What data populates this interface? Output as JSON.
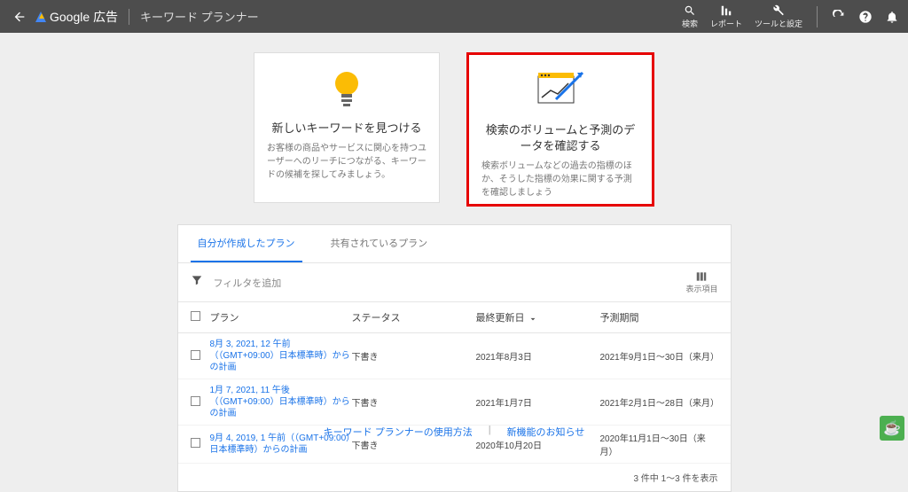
{
  "header": {
    "product_label": "Google 広告",
    "tool_title": "キーワード プランナー",
    "search_label": "検索",
    "report_label": "レポート",
    "tools_label": "ツールと設定"
  },
  "cards": {
    "discover": {
      "title": "新しいキーワードを見つける",
      "desc": "お客様の商品やサービスに関心を持つユーザーへのリーチにつながる、キーワードの候補を探してみましょう。"
    },
    "volume": {
      "title": "検索のボリュームと予測のデータを確認する",
      "desc": "検索ボリュームなどの過去の指標のほか、そうした指標の効果に関する予測を確認しましょう"
    }
  },
  "tabs": {
    "mine": "自分が作成したプラン",
    "shared": "共有されているプラン"
  },
  "filter": {
    "label": "フィルタを追加",
    "columns_label": "表示項目"
  },
  "table": {
    "headers": {
      "plan": "プラン",
      "status": "ステータス",
      "updated": "最終更新日",
      "period": "予測期間"
    },
    "rows": [
      {
        "plan": "8月 3, 2021, 12 午前（（GMT+09:00）日本標準時）からの計画",
        "status": "下書き",
        "updated": "2021年8月3日",
        "period": "2021年9月1日～30日（来月）"
      },
      {
        "plan": "1月 7, 2021, 11 午後（（GMT+09:00）日本標準時）からの計画",
        "status": "下書き",
        "updated": "2021年1月7日",
        "period": "2021年2月1日～28日（来月）"
      },
      {
        "plan": "9月 4, 2019, 1 午前（（GMT+09:00）日本標準時）からの計画",
        "status": "下書き",
        "updated": "2020年10月20日",
        "period": "2020年11月1日～30日（来月）"
      }
    ],
    "footer": "3 件中 1～3 件を表示"
  },
  "footer_links": {
    "howto": "キーワード プランナーの使用方法",
    "news": "新機能のお知らせ"
  }
}
